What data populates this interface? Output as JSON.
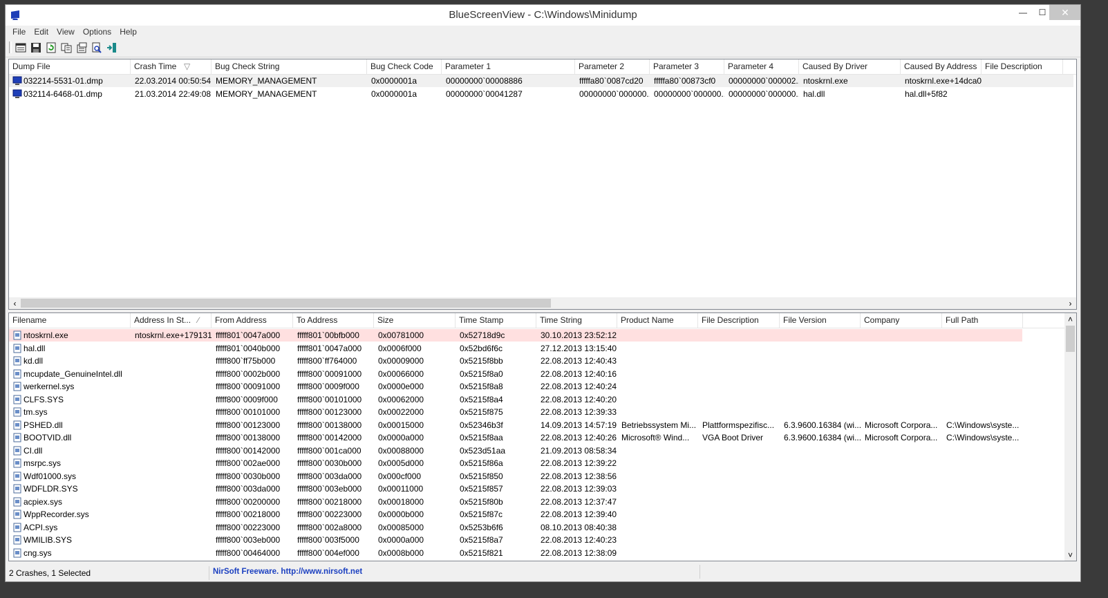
{
  "window": {
    "title": "BlueScreenView  -  C:\\Windows\\Minidump"
  },
  "window_buttons": {
    "minimize": "—",
    "maximize": "☐",
    "close": "✕"
  },
  "menu": [
    "File",
    "Edit",
    "View",
    "Options",
    "Help"
  ],
  "toolbar": {
    "icons": [
      "html-report-icon",
      "save-icon",
      "refresh-icon",
      "copy-icon",
      "properties-icon",
      "find-icon",
      "exit-icon"
    ]
  },
  "dumps": {
    "columns": [
      "Dump File",
      "Crash Time",
      "Bug Check String",
      "Bug Check Code",
      "Parameter 1",
      "Parameter 2",
      "Parameter 3",
      "Parameter 4",
      "Caused By Driver",
      "Caused By Address",
      "File Description"
    ],
    "sort_indicator": "▽",
    "rows": [
      [
        "032214-5531-01.dmp",
        "22.03.2014 00:50:54",
        "MEMORY_MANAGEMENT",
        "0x0000001a",
        "00000000`00008886",
        "fffffa80`0087cd20",
        "fffffa80`00873cf0",
        "00000000`000002...",
        "ntoskrnl.exe",
        "ntoskrnl.exe+14dca0",
        ""
      ],
      [
        "032114-6468-01.dmp",
        "21.03.2014 22:49:08",
        "MEMORY_MANAGEMENT",
        "0x0000001a",
        "00000000`00041287",
        "00000000`000000...",
        "00000000`000000...",
        "00000000`000000...",
        "hal.dll",
        "hal.dll+5f82",
        ""
      ]
    ]
  },
  "drivers": {
    "columns": [
      "Filename",
      "Address In St...",
      "From Address",
      "To Address",
      "Size",
      "Time Stamp",
      "Time String",
      "Product Name",
      "File Description",
      "File Version",
      "Company",
      "Full Path"
    ],
    "sort_indicator": "∕",
    "rows": [
      [
        "ntoskrnl.exe",
        "ntoskrnl.exe+179131",
        "fffff801`0047a000",
        "fffff801`00bfb000",
        "0x00781000",
        "0x52718d9c",
        "30.10.2013 23:52:12",
        "",
        "",
        "",
        "",
        ""
      ],
      [
        "hal.dll",
        "",
        "fffff801`0040b000",
        "fffff801`0047a000",
        "0x0006f000",
        "0x52bd6f6c",
        "27.12.2013 13:15:40",
        "",
        "",
        "",
        "",
        ""
      ],
      [
        "kd.dll",
        "",
        "fffff800`ff75b000",
        "fffff800`ff764000",
        "0x00009000",
        "0x5215f8bb",
        "22.08.2013 12:40:43",
        "",
        "",
        "",
        "",
        ""
      ],
      [
        "mcupdate_GenuineIntel.dll",
        "",
        "fffff800`0002b000",
        "fffff800`00091000",
        "0x00066000",
        "0x5215f8a0",
        "22.08.2013 12:40:16",
        "",
        "",
        "",
        "",
        ""
      ],
      [
        "werkernel.sys",
        "",
        "fffff800`00091000",
        "fffff800`0009f000",
        "0x0000e000",
        "0x5215f8a8",
        "22.08.2013 12:40:24",
        "",
        "",
        "",
        "",
        ""
      ],
      [
        "CLFS.SYS",
        "",
        "fffff800`0009f000",
        "fffff800`00101000",
        "0x00062000",
        "0x5215f8a4",
        "22.08.2013 12:40:20",
        "",
        "",
        "",
        "",
        ""
      ],
      [
        "tm.sys",
        "",
        "fffff800`00101000",
        "fffff800`00123000",
        "0x00022000",
        "0x5215f875",
        "22.08.2013 12:39:33",
        "",
        "",
        "",
        "",
        ""
      ],
      [
        "PSHED.dll",
        "",
        "fffff800`00123000",
        "fffff800`00138000",
        "0x00015000",
        "0x52346b3f",
        "14.09.2013 14:57:19",
        "Betriebssystem Mi...",
        "Plattformspezifisc...",
        "6.3.9600.16384 (wi...",
        "Microsoft Corpora...",
        "C:\\Windows\\syste..."
      ],
      [
        "BOOTVID.dll",
        "",
        "fffff800`00138000",
        "fffff800`00142000",
        "0x0000a000",
        "0x5215f8aa",
        "22.08.2013 12:40:26",
        "Microsoft® Wind...",
        "VGA Boot Driver",
        "6.3.9600.16384 (wi...",
        "Microsoft Corpora...",
        "C:\\Windows\\syste..."
      ],
      [
        "CI.dll",
        "",
        "fffff800`00142000",
        "fffff800`001ca000",
        "0x00088000",
        "0x523d51aa",
        "21.09.2013 08:58:34",
        "",
        "",
        "",
        "",
        ""
      ],
      [
        "msrpc.sys",
        "",
        "fffff800`002ae000",
        "fffff800`0030b000",
        "0x0005d000",
        "0x5215f86a",
        "22.08.2013 12:39:22",
        "",
        "",
        "",
        "",
        ""
      ],
      [
        "Wdf01000.sys",
        "",
        "fffff800`0030b000",
        "fffff800`003da000",
        "0x000cf000",
        "0x5215f850",
        "22.08.2013 12:38:56",
        "",
        "",
        "",
        "",
        ""
      ],
      [
        "WDFLDR.SYS",
        "",
        "fffff800`003da000",
        "fffff800`003eb000",
        "0x00011000",
        "0x5215f857",
        "22.08.2013 12:39:03",
        "",
        "",
        "",
        "",
        ""
      ],
      [
        "acpiex.sys",
        "",
        "fffff800`00200000",
        "fffff800`00218000",
        "0x00018000",
        "0x5215f80b",
        "22.08.2013 12:37:47",
        "",
        "",
        "",
        "",
        ""
      ],
      [
        "WppRecorder.sys",
        "",
        "fffff800`00218000",
        "fffff800`00223000",
        "0x0000b000",
        "0x5215f87c",
        "22.08.2013 12:39:40",
        "",
        "",
        "",
        "",
        ""
      ],
      [
        "ACPI.sys",
        "",
        "fffff800`00223000",
        "fffff800`002a8000",
        "0x00085000",
        "0x5253b6f6",
        "08.10.2013 08:40:38",
        "",
        "",
        "",
        "",
        ""
      ],
      [
        "WMILIB.SYS",
        "",
        "fffff800`003eb000",
        "fffff800`003f5000",
        "0x0000a000",
        "0x5215f8a7",
        "22.08.2013 12:40:23",
        "",
        "",
        "",
        "",
        ""
      ],
      [
        "cng.sys",
        "",
        "fffff800`00464000",
        "fffff800`004ef000",
        "0x0008b000",
        "0x5215f821",
        "22.08.2013 12:38:09",
        "",
        "",
        "",
        "",
        ""
      ]
    ]
  },
  "status": {
    "count": "2 Crashes, 1 Selected",
    "link": "NirSoft Freeware.  http://www.nirsoft.net"
  },
  "scroll_arrows": {
    "left": "‹",
    "right": "›",
    "up": "˄",
    "down": "˅"
  },
  "colors": {
    "accent_link": "#1a3fc0",
    "selected_pink": "#ffe0e0",
    "selected_gray": "#f0f0f0"
  }
}
